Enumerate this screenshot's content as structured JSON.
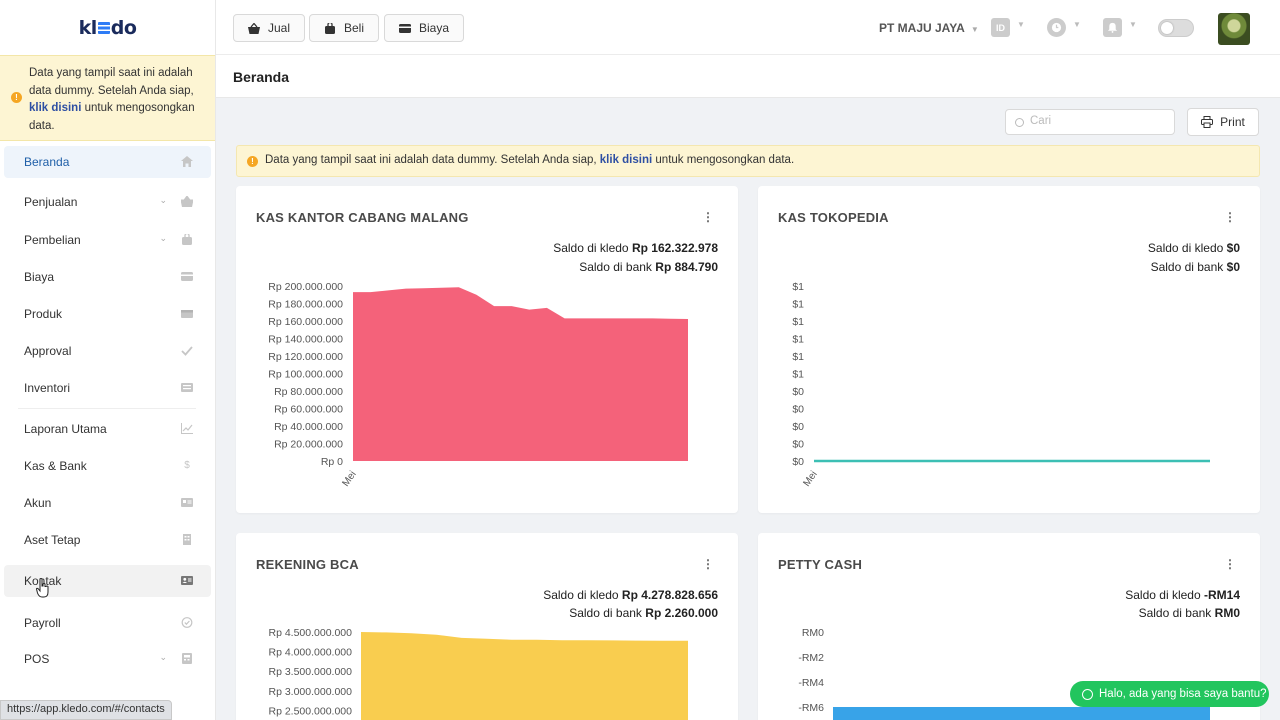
{
  "sidebar": {
    "logo": {
      "pre": "kl",
      "post": "do"
    },
    "notice": {
      "text1": "Data yang tampil saat ini adalah data dummy. Setelah Anda siap, ",
      "link": "klik disini",
      "text2": " untuk mengosongkan data."
    },
    "items": [
      {
        "label": "Beranda",
        "icon": "home-icon"
      },
      {
        "label": "Penjualan",
        "icon": "basket-icon"
      },
      {
        "label": "Pembelian",
        "icon": "bag-icon"
      },
      {
        "label": "Biaya",
        "icon": "card-icon"
      },
      {
        "label": "Produk",
        "icon": "box-icon"
      },
      {
        "label": "Approval",
        "icon": "check-icon"
      },
      {
        "label": "Inventori",
        "icon": "inventory-icon"
      },
      {
        "label": "Laporan Utama",
        "icon": "chart-icon"
      },
      {
        "label": "Kas & Bank",
        "icon": "dollar-icon"
      },
      {
        "label": "Akun",
        "icon": "account-icon"
      },
      {
        "label": "Aset Tetap",
        "icon": "building-icon"
      },
      {
        "label": "Kontak",
        "icon": "contact-icon"
      },
      {
        "label": "Payroll",
        "icon": "payroll-icon"
      },
      {
        "label": "POS",
        "icon": "pos-icon"
      }
    ],
    "status_url": "https://app.kledo.com/#/contacts"
  },
  "topbar": {
    "jual": "Jual",
    "beli": "Beli",
    "biaya": "Biaya",
    "company": "PT MAJU JAYA",
    "lang": "ID"
  },
  "page": {
    "title": "Beranda",
    "search_placeholder": "Cari",
    "print": "Print",
    "banner": {
      "text1": "Data yang tampil saat ini adalah data dummy. Setelah Anda siap, ",
      "link": "klik disini",
      "text2": " untuk mengosongkan data."
    }
  },
  "cards": [
    {
      "title": "KAS KANTOR CABANG MALANG",
      "saldo_kledo_label": "Saldo di kledo",
      "saldo_kledo": "Rp 162.322.978",
      "saldo_bank_label": "Saldo di bank",
      "saldo_bank": "Rp 884.790"
    },
    {
      "title": "KAS TOKOPEDIA",
      "saldo_kledo_label": "Saldo di kledo",
      "saldo_kledo": "$0",
      "saldo_bank_label": "Saldo di bank",
      "saldo_bank": "$0"
    },
    {
      "title": "REKENING BCA",
      "saldo_kledo_label": "Saldo di kledo",
      "saldo_kledo": "Rp 4.278.828.656",
      "saldo_bank_label": "Saldo di bank",
      "saldo_bank": "Rp 2.260.000"
    },
    {
      "title": "PETTY CASH",
      "saldo_kledo_label": "Saldo di kledo",
      "saldo_kledo": "-RM14",
      "saldo_bank_label": "Saldo di bank",
      "saldo_bank": "RM0"
    }
  ],
  "chart_data": [
    {
      "type": "area",
      "color": "#f4627a",
      "yticks": [
        "Rp 200.000.000",
        "Rp 180.000.000",
        "Rp 160.000.000",
        "Rp 140.000.000",
        "Rp 120.000.000",
        "Rp 100.000.000",
        "Rp 80.000.000",
        "Rp 60.000.000",
        "Rp 40.000.000",
        "Rp 20.000.000",
        "Rp 0"
      ],
      "ylim": [
        0,
        200000000
      ],
      "xticks": [
        "Mei"
      ],
      "values": [
        193000000,
        193000000,
        195000000,
        197000000,
        197500000,
        198000000,
        198500000,
        190000000,
        177000000,
        177000000,
        173000000,
        175000000,
        163000000,
        163000000,
        163000000,
        163000000,
        163000000,
        163000000,
        162500000,
        162322978
      ]
    },
    {
      "type": "line",
      "color": "#3cbfb4",
      "yticks": [
        "$1",
        "$1",
        "$1",
        "$1",
        "$1",
        "$1",
        "$0",
        "$0",
        "$0",
        "$0",
        "$0"
      ],
      "ylim": [
        0,
        1
      ],
      "xticks": [
        "Mei"
      ],
      "values": [
        0,
        0
      ]
    },
    {
      "type": "area",
      "color": "#f9cd4f",
      "yticks": [
        "Rp 4.500.000.000",
        "Rp 4.000.000.000",
        "Rp 3.500.000.000",
        "Rp 3.000.000.000",
        "Rp 2.500.000.000"
      ],
      "ylim": [
        2500000000,
        4500000000
      ],
      "values": [
        4500000000,
        4490000000,
        4470000000,
        4430000000,
        4350000000,
        4330000000,
        4300000000,
        4300000000,
        4290000000,
        4290000000,
        4285000000,
        4280000000,
        4279000000,
        4278828656
      ]
    },
    {
      "type": "area",
      "color": "#38a3e8",
      "yticks": [
        "RM0",
        "-RM2",
        "-RM4",
        "-RM6"
      ],
      "ylim": [
        -6,
        0
      ],
      "values": [
        -14,
        -14
      ]
    }
  ]
}
